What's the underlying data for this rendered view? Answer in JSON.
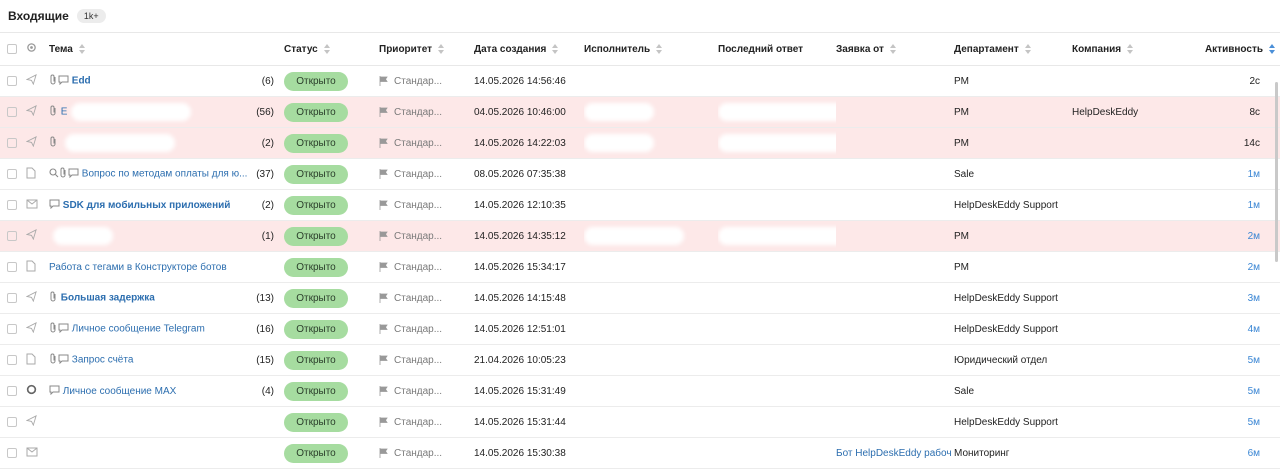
{
  "header": {
    "title": "Входящие",
    "count_badge": "1k+"
  },
  "columns": {
    "subject": "Тема",
    "status": "Статус",
    "priority": "Приоритет",
    "created": "Дата создания",
    "assignee": "Исполнитель",
    "last_reply": "Последний ответ",
    "requester": "Заявка от",
    "department": "Департамент",
    "company": "Компания",
    "activity": "Активность"
  },
  "rows": [
    {
      "subject": "Edd",
      "bold": true,
      "count": "(6)",
      "status": "Открыто",
      "priority": "Стандар...",
      "created": "14.05.2026 14:56:46",
      "department": "PM",
      "company": "",
      "activity": "2с",
      "requester": ""
    },
    {
      "subject": "Е",
      "bold": false,
      "count": "(56)",
      "status": "Открыто",
      "priority": "Стандар...",
      "created": "04.05.2026 10:46:00",
      "department": "PM",
      "company": "HelpDeskEddy",
      "activity": "8с",
      "requester": ""
    },
    {
      "subject": "",
      "bold": false,
      "count": "(2)",
      "status": "Открыто",
      "priority": "Стандар...",
      "created": "14.05.2026 14:22:03",
      "department": "PM",
      "company": "",
      "activity": "14с",
      "requester": ""
    },
    {
      "subject": "Вопрос по методам оплаты для ю...",
      "bold": false,
      "count": "(37)",
      "status": "Открыто",
      "priority": "Стандар...",
      "created": "08.05.2026 07:35:38",
      "department": "Sale",
      "company": "",
      "activity": "1м",
      "requester": ""
    },
    {
      "subject": "SDK для мобильных приложений",
      "bold": true,
      "count": "(2)",
      "status": "Открыто",
      "priority": "Стандар...",
      "created": "14.05.2026 12:10:35",
      "department": "HelpDeskEddy Support",
      "company": "",
      "activity": "1м",
      "requester": ""
    },
    {
      "subject": "",
      "bold": false,
      "count": "(1)",
      "status": "Открыто",
      "priority": "Стандар...",
      "created": "14.05.2026 14:35:12",
      "department": "PM",
      "company": "",
      "activity": "2м",
      "requester": ""
    },
    {
      "subject": "Работа с тегами в Конструкторе ботов",
      "bold": false,
      "count": "",
      "status": "Открыто",
      "priority": "Стандар...",
      "created": "14.05.2026 15:34:17",
      "department": "PM",
      "company": "",
      "activity": "2м",
      "requester": ""
    },
    {
      "subject": "Большая задержка",
      "bold": true,
      "count": "(13)",
      "status": "Открыто",
      "priority": "Стандар...",
      "created": "14.05.2026 14:15:48",
      "department": "HelpDeskEddy Support",
      "company": "",
      "activity": "3м",
      "requester": ""
    },
    {
      "subject": "Личное сообщение Telegram",
      "bold": false,
      "count": "(16)",
      "status": "Открыто",
      "priority": "Стандар...",
      "created": "14.05.2026 12:51:01",
      "department": "HelpDeskEddy Support",
      "company": "",
      "activity": "4м",
      "requester": ""
    },
    {
      "subject": "Запрос счёта",
      "bold": false,
      "count": "(15)",
      "status": "Открыто",
      "priority": "Стандар...",
      "created": "21.04.2026 10:05:23",
      "department": "Юридический отдел",
      "company": "",
      "activity": "5м",
      "requester": ""
    },
    {
      "subject": "Личное сообщение MAX",
      "bold": false,
      "count": "(4)",
      "status": "Открыто",
      "priority": "Стандар...",
      "created": "14.05.2026 15:31:49",
      "department": "Sale",
      "company": "",
      "activity": "5м",
      "requester": ""
    },
    {
      "subject": "",
      "bold": false,
      "count": "",
      "status": "Открыто",
      "priority": "Стандар...",
      "created": "14.05.2026 15:31:44",
      "department": "HelpDeskEddy Support",
      "company": "",
      "activity": "5м",
      "requester": ""
    },
    {
      "subject": "",
      "bold": false,
      "count": "",
      "status": "Открыто",
      "priority": "Стандар...",
      "created": "14.05.2026 15:30:38",
      "department": "Мониторинг",
      "company": "",
      "activity": "6м",
      "requester": "Бот HelpDeskEddy рабоч"
    }
  ]
}
